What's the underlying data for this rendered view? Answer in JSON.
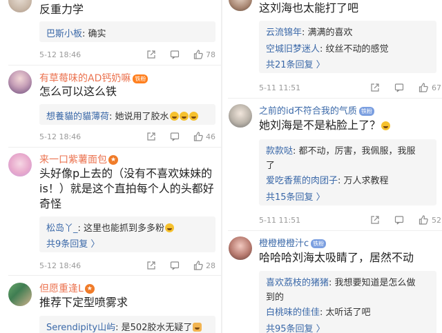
{
  "left": {
    "c0": {
      "text": "反重力学",
      "reply_user": "巴斯小板",
      "reply_text": ": 确实",
      "date": "5-12 18:46",
      "likes": "78"
    },
    "c1": {
      "user": "有草莓味的AD钙奶嘛",
      "text": "怎么可以这么铁",
      "reply_user": "想養貓的貓薄荷",
      "reply_text": ": 她说用了胶水",
      "date": "5-12 18:46",
      "likes": "46"
    },
    "c2": {
      "user": "来一口紫薯面包",
      "text_l1": "头好像p上去的（没有不喜欢妹妹的",
      "text_l2": "is！）就是这个直拍每个人的头都好",
      "text_l3": "奇怪",
      "reply_user": "松岛丫_",
      "reply_text": ": 这里也能抓到多多粉",
      "more": "共9条回复 〉",
      "date": "5-12 18:46",
      "likes": "28"
    },
    "c3": {
      "user": "但愿重逢L",
      "text": "推荐下定型喷雾求",
      "reply_user": "Serendipity山屿",
      "reply_text": ": 是502胶水无疑了"
    }
  },
  "right": {
    "c0": {
      "text": "这刘海也太能打了吧",
      "r1_user": "云流锦年",
      "r1_text": ": 满满的喜欢",
      "r2_user": "空城旧梦迷人",
      "r2_text": ": 纹丝不动的感觉",
      "more": "共21条回复 〉",
      "date": "5-11 11:51",
      "likes": "67"
    },
    "c1": {
      "user": "之前的id不符合我的气质",
      "text": "她刘海是不是粘脸上了？",
      "r1_user": "款款哒",
      "r1_text_l1": ": 都不动，厉害，我佩服，我服",
      "r1_text_l2": "了",
      "r2_user": "爱吃香蕉的肉团子",
      "r2_text": ": 万人求教程",
      "more": "共15条回复 〉",
      "date": "5-11 11:51",
      "likes": "52"
    },
    "c2": {
      "user": "橙橙橙橙汁c",
      "text": "哈哈哈刘海太吸睛了，居然不动",
      "r1_user": "喜欢荔枝的猪猪",
      "r1_text_l1": ": 我想要知道是怎么做",
      "r1_text_l2": "到的",
      "r2_user": "白桃味的佳佳",
      "r2_text": ": 太听话了吧",
      "more": "共95条回复 〉"
    }
  },
  "badges": {
    "vip": "铁粉"
  },
  "icons": [
    "share-icon",
    "comment-icon",
    "like-icon"
  ],
  "colors": {
    "username": "#eb7350",
    "link": "#3a68a8",
    "meta": "#999999",
    "subbox": "#f5f5f5"
  }
}
